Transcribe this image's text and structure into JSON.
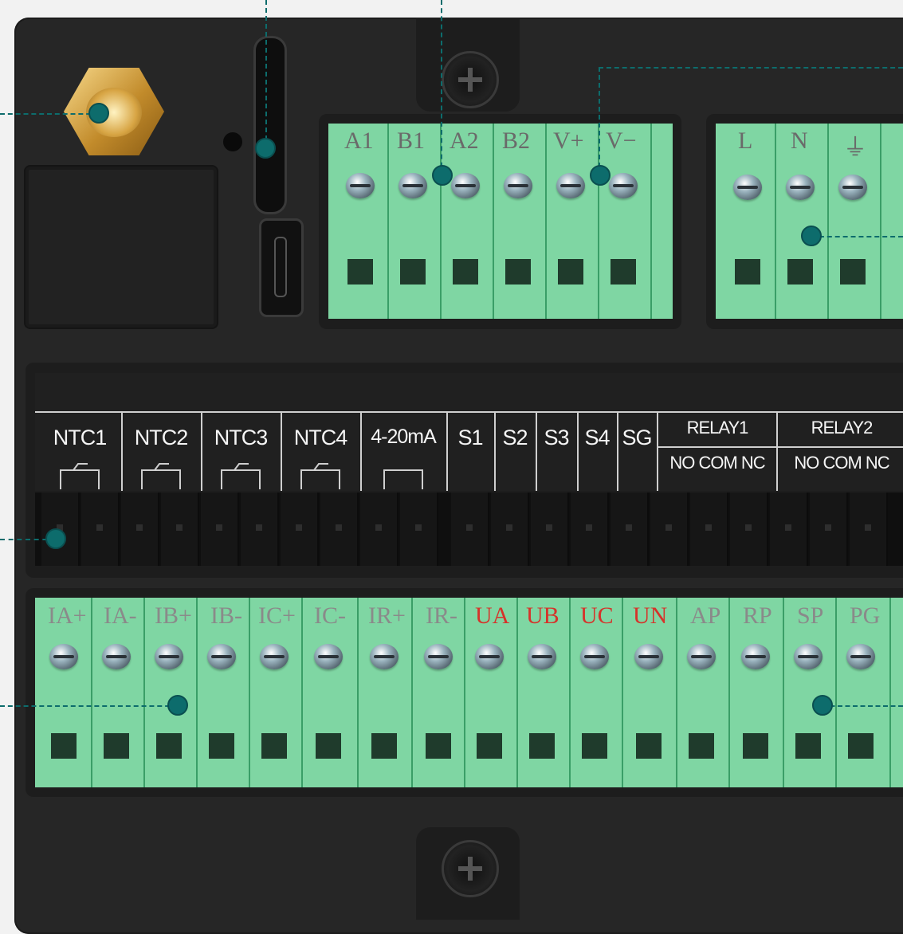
{
  "top_terminal": {
    "labels": [
      "A1",
      "B1",
      "A2",
      "B2",
      "V+",
      "V−"
    ]
  },
  "power_terminal": {
    "labels": [
      "L",
      "N",
      "⏚"
    ]
  },
  "signal_header": {
    "labels": [
      "NTC1",
      "NTC2",
      "NTC3",
      "NTC4",
      "4-20mA",
      "S1",
      "S2",
      "S3",
      "S4",
      "SG"
    ],
    "relay1": "RELAY1",
    "relay2": "RELAY2",
    "relay_sub1": "NO COM NC",
    "relay_sub2": "NO COM NC"
  },
  "bottom_terminal": {
    "labels": [
      {
        "text": "IA+",
        "color": "#8a8a8a"
      },
      {
        "text": "IA-",
        "color": "#8a8a8a"
      },
      {
        "text": "IB+",
        "color": "#8a8a8a"
      },
      {
        "text": "IB-",
        "color": "#8a8a8a"
      },
      {
        "text": "IC+",
        "color": "#8a8a8a"
      },
      {
        "text": "IC-",
        "color": "#8a8a8a"
      },
      {
        "text": "IR+",
        "color": "#8a8a8a"
      },
      {
        "text": "IR-",
        "color": "#8a8a8a"
      },
      {
        "text": "UA",
        "color": "#d6322a"
      },
      {
        "text": "UB",
        "color": "#d6322a"
      },
      {
        "text": "UC",
        "color": "#d6322a"
      },
      {
        "text": "UN",
        "color": "#d6322a"
      },
      {
        "text": "AP",
        "color": "#8a8a8a"
      },
      {
        "text": "RP",
        "color": "#8a8a8a"
      },
      {
        "text": "SP",
        "color": "#8a8a8a"
      },
      {
        "text": "PG",
        "color": "#8a8a8a"
      }
    ]
  },
  "colors": {
    "terminal_green": "#7fd6a3",
    "housing": "#262626",
    "callout": "#0d6c6c",
    "voltage_label_red": "#d6322a"
  },
  "icons": [
    "antenna-connector-icon",
    "screw-icon",
    "usb-port-icon",
    "thermistor-symbol-icon"
  ]
}
